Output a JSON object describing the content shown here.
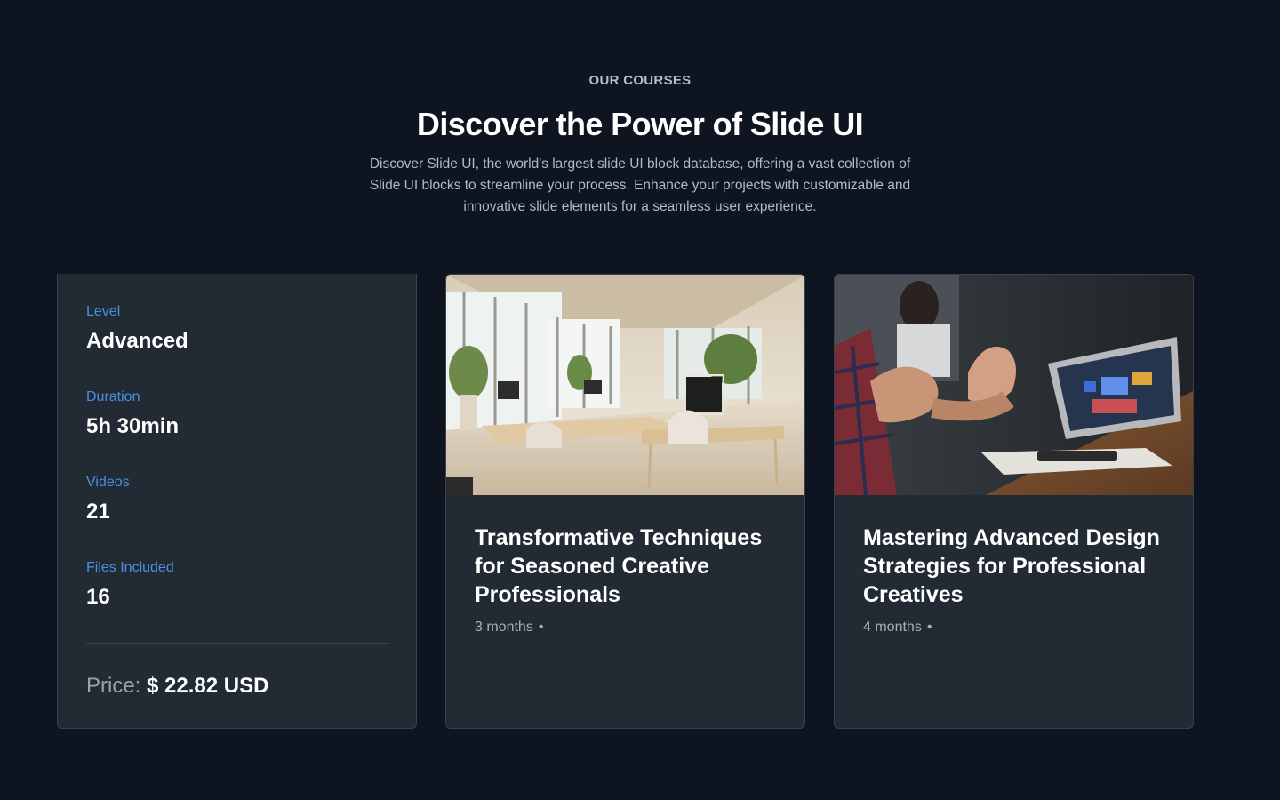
{
  "header": {
    "eyebrow": "OUR COURSES",
    "title": "Discover the Power of Slide UI",
    "description": "Discover Slide UI, the world's largest slide UI block database, offering a vast collection of Slide UI blocks to streamline your process. Enhance your projects with customizable and innovative slide elements for a seamless user experience."
  },
  "info_card": {
    "stats": [
      {
        "label": "Level",
        "value": "Advanced"
      },
      {
        "label": "Duration",
        "value": "5h 30min"
      },
      {
        "label": "Videos",
        "value": "21"
      },
      {
        "label": "Files Included",
        "value": "16"
      }
    ],
    "price_label": "Price:",
    "price_value": "$ 22.82 USD"
  },
  "courses": [
    {
      "title": "Transformative Techniques for Seasoned Creative Professionals",
      "duration": "3 months",
      "separator": "•",
      "image": "office-interior-photo"
    },
    {
      "title": "Mastering Advanced Design Strategies for Professional Creatives",
      "duration": "4 months",
      "separator": "•",
      "image": "meditation-laptop-photo"
    }
  ],
  "colors": {
    "background": "#0f1520",
    "card": "#222a33",
    "accent": "#4a90e2"
  }
}
